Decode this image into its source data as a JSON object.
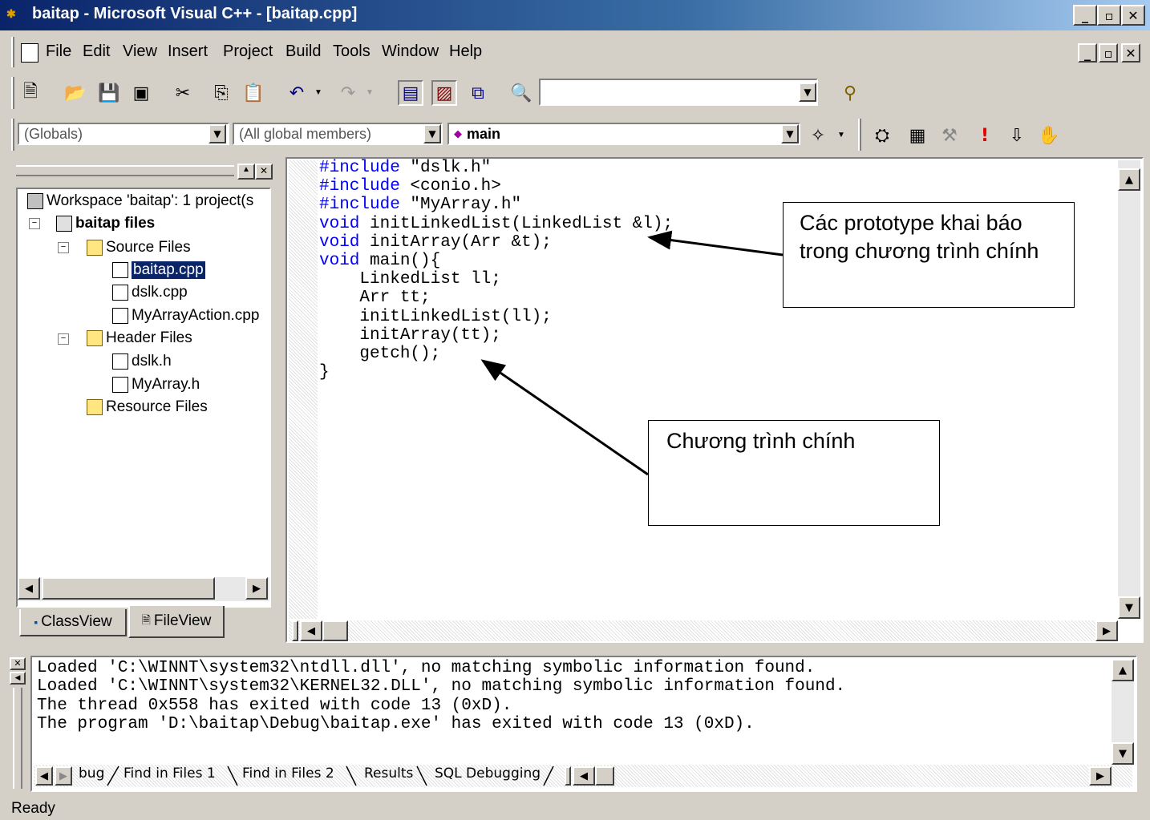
{
  "window": {
    "title": "baitap - Microsoft Visual C++ - [baitap.cpp]",
    "minimize": "_",
    "maximize": "▫",
    "close": "✕"
  },
  "menu": [
    "File",
    "Edit",
    "View",
    "Insert",
    "Project",
    "Build",
    "Tools",
    "Window",
    "Help"
  ],
  "wizardbar": {
    "scope": "(Globals)",
    "members": "(All global members)",
    "function": "main"
  },
  "workspace": {
    "rows": [
      {
        "label": "Workspace 'baitap': 1 project(s",
        "icon": "workspace-icon"
      },
      {
        "label": "baitap files",
        "icon": "project-icon"
      },
      {
        "label": "Source Files",
        "icon": "folder-icon"
      },
      {
        "label": "baitap.cpp",
        "icon": "cpp-file-icon"
      },
      {
        "label": "dslk.cpp",
        "icon": "cpp-file-icon"
      },
      {
        "label": "MyArrayAction.cpp",
        "icon": "cpp-file-icon"
      },
      {
        "label": "Header Files",
        "icon": "folder-icon"
      },
      {
        "label": "dslk.h",
        "icon": "header-file-icon"
      },
      {
        "label": "MyArray.h",
        "icon": "header-file-icon"
      },
      {
        "label": "Resource Files",
        "icon": "folder-icon"
      }
    ],
    "tabs": [
      "ClassView",
      "FileView"
    ]
  },
  "editor": {
    "lines": [
      {
        "kw": "#include",
        "rest": " \"dslk.h\""
      },
      {
        "kw": "#include",
        "rest": " <conio.h>"
      },
      {
        "kw": "#include",
        "rest": " \"MyArray.h\""
      },
      {
        "kw": "void",
        "rest": " initLinkedList(LinkedList &l);"
      },
      {
        "kw": "void",
        "rest": " initArray(Arr &t);"
      },
      {
        "kw": "void",
        "rest": " main(){"
      },
      {
        "kw": "",
        "rest": "    LinkedList ll;"
      },
      {
        "kw": "",
        "rest": "    Arr tt;"
      },
      {
        "kw": "",
        "rest": "    initLinkedList(ll);"
      },
      {
        "kw": "",
        "rest": "    initArray(tt);"
      },
      {
        "kw": "",
        "rest": "    getch();"
      },
      {
        "kw": "",
        "rest": "}"
      }
    ]
  },
  "annotations": {
    "prototype": "Các prototype khai báo trong chương trình chính",
    "main": "Chương trình chính"
  },
  "output": {
    "lines": [
      "Loaded 'C:\\WINNT\\system32\\ntdll.dll', no matching symbolic information found.",
      "Loaded 'C:\\WINNT\\system32\\KERNEL32.DLL', no matching symbolic information found.",
      "The thread 0x558 has exited with code 13 (0xD).",
      "The program 'D:\\baitap\\Debug\\baitap.exe' has exited with code 13 (0xD)."
    ],
    "tabs": [
      "bug",
      "Find in Files 1",
      "Find in Files 2",
      "Results",
      "SQL Debugging"
    ]
  },
  "status": "Ready"
}
